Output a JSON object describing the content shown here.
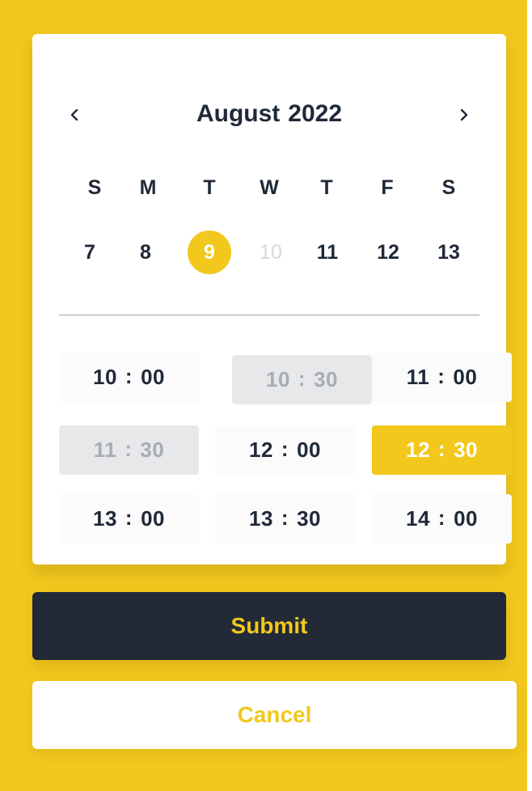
{
  "calendar": {
    "month": "August",
    "year": "2022",
    "prev_icon": "chevron-left-icon",
    "next_icon": "chevron-right-icon",
    "weekdays": [
      "S",
      "M",
      "T",
      "W",
      "T",
      "F",
      "S"
    ],
    "days": [
      {
        "label": "7",
        "state": "default"
      },
      {
        "label": "8",
        "state": "default"
      },
      {
        "label": "9",
        "state": "selected"
      },
      {
        "label": "10",
        "state": "disabled"
      },
      {
        "label": "11",
        "state": "default"
      },
      {
        "label": "12",
        "state": "default"
      },
      {
        "label": "13",
        "state": "default"
      }
    ]
  },
  "time_slots": [
    {
      "hour": "10",
      "minute": "00",
      "state": "available"
    },
    {
      "hour": "10",
      "minute": "30",
      "state": "unavailable"
    },
    {
      "hour": "11",
      "minute": "00",
      "state": "available"
    },
    {
      "hour": "11",
      "minute": "30",
      "state": "unavailable"
    },
    {
      "hour": "12",
      "minute": "00",
      "state": "available"
    },
    {
      "hour": "12",
      "minute": "30",
      "state": "selected"
    },
    {
      "hour": "13",
      "minute": "00",
      "state": "available"
    },
    {
      "hour": "13",
      "minute": "30",
      "state": "available"
    },
    {
      "hour": "14",
      "minute": "00",
      "state": "available"
    }
  ],
  "time_separator": ":",
  "actions": {
    "submit_label": "Submit",
    "cancel_label": "Cancel"
  },
  "colors": {
    "accent": "#F2C81D",
    "dark": "#222A37",
    "text": "#1F2937",
    "muted": "#A8ADB4",
    "disabled": "#D7D9DE"
  }
}
